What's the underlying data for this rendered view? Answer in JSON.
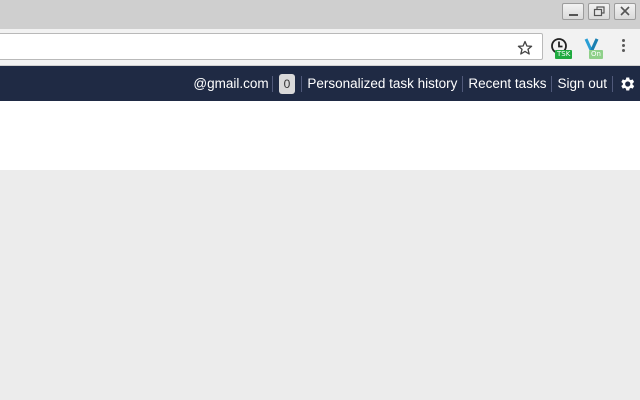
{
  "window": {
    "controls": [
      "minimize-icon",
      "restore-icon",
      "close-icon"
    ]
  },
  "toolbar": {
    "omnibox_value": "",
    "star_icon": "star-icon",
    "extensions": [
      {
        "icon": "clock-icon",
        "badge": "TSK",
        "badge_color": "#1faa3f"
      },
      {
        "icon": "v-logo-icon",
        "badge": "On",
        "badge_color": "#8fd08a"
      }
    ],
    "menu_icon": "kebab-menu-icon"
  },
  "header": {
    "email": "@gmail.com",
    "count": "0",
    "links": {
      "history": "Personalized task history",
      "recent": "Recent tasks",
      "signout": "Sign out"
    },
    "settings_icon": "gear-icon",
    "bg_color": "#1f2a44"
  }
}
